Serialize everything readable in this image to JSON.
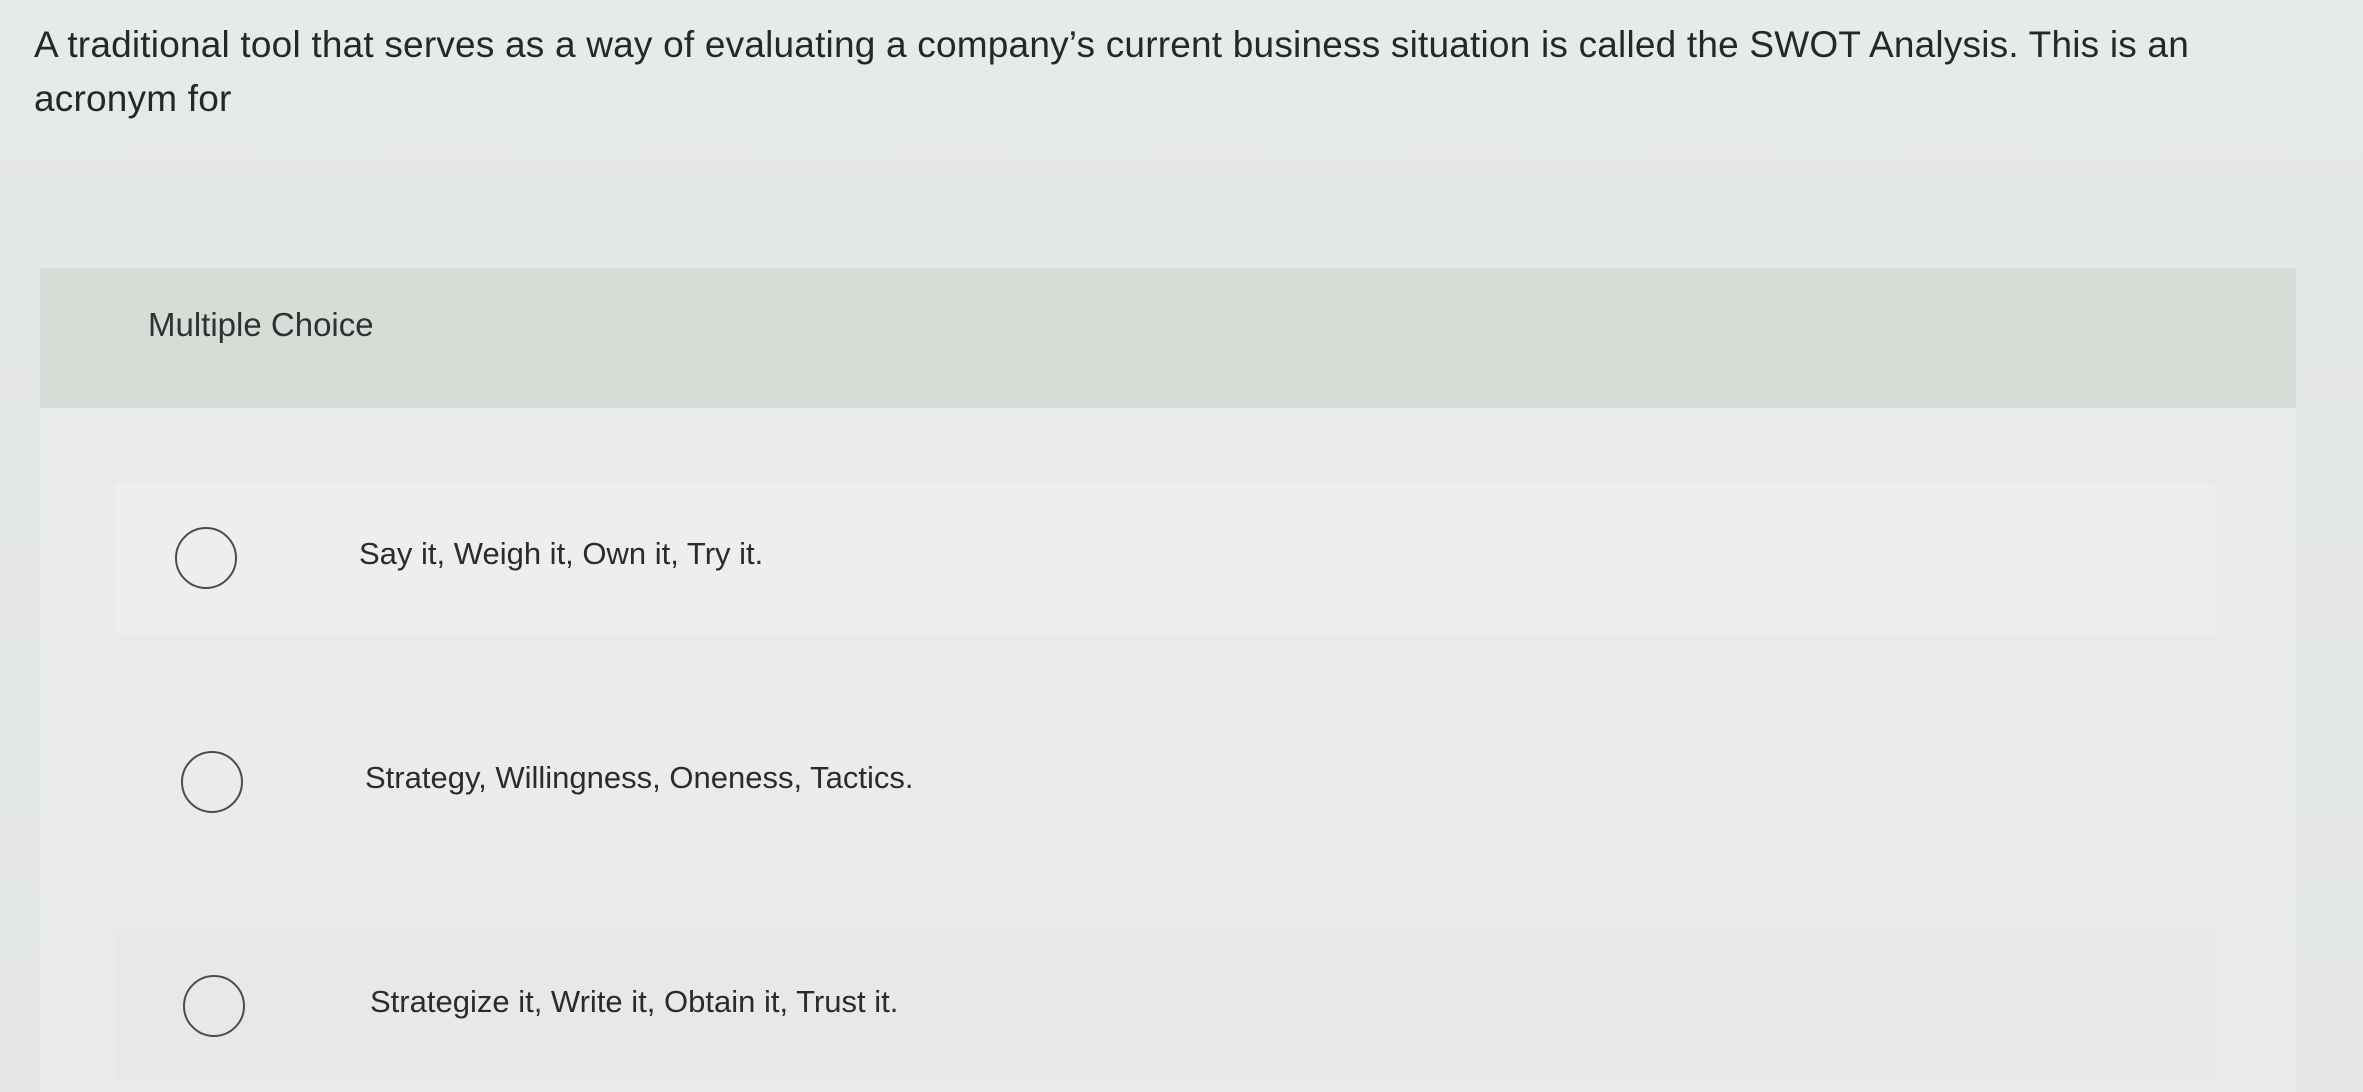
{
  "question": {
    "text": "A traditional tool that serves as a way of evaluating a company’s current business situation is called the SWOT Analysis. This is an acronym for"
  },
  "panel": {
    "title": "Multiple Choice",
    "options": [
      {
        "label": "Say it, Weigh it, Own it, Try it.",
        "icon": "radio-unchecked"
      },
      {
        "label": "Strategy, Willingness, Oneness, Tactics.",
        "icon": "radio-unchecked"
      },
      {
        "label": "Strategize it, Write it, Obtain it, Trust it.",
        "icon": "radio-unchecked"
      }
    ]
  }
}
